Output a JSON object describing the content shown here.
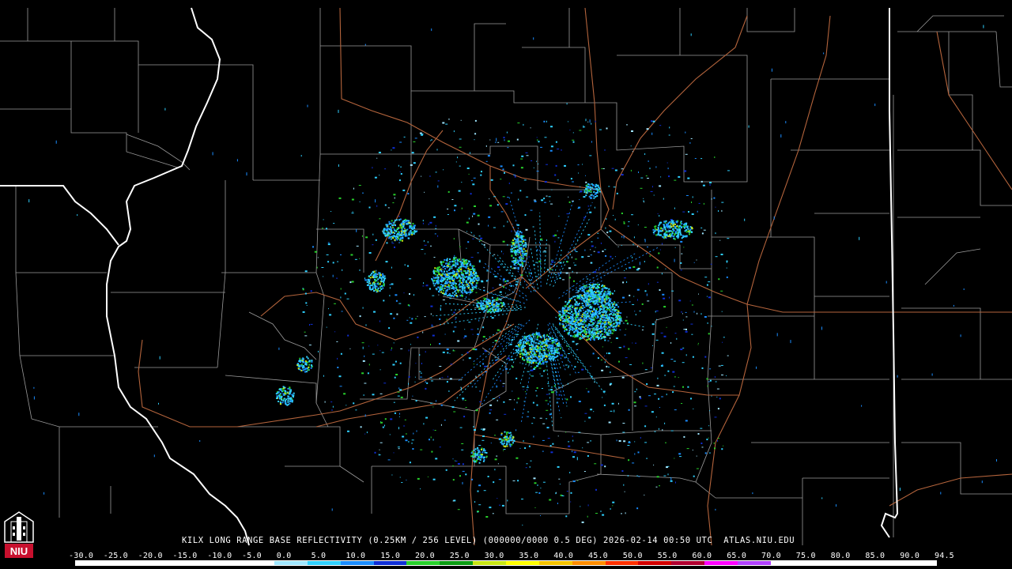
{
  "product": {
    "caption": "KILX LONG RANGE BASE REFLECTIVITY (0.25KM / 256 LEVEL) (000000/0000 0.5 DEG) 2026-02-14 00:50 UTC  ATLAS.NIU.EDU"
  },
  "logo": {
    "text": "NIU"
  },
  "colorscale": {
    "labels": [
      "-30.0",
      "-25.0",
      "-20.0",
      "-15.0",
      "-10.0",
      "-5.0",
      "0.0",
      "5.0",
      "10.0",
      "15.0",
      "20.0",
      "25.0",
      "30.0",
      "35.0",
      "40.0",
      "45.0",
      "50.0",
      "55.0",
      "60.0",
      "65.0",
      "70.0",
      "75.0",
      "80.0",
      "85.0",
      "90.0",
      "94.5"
    ],
    "colors": [
      "#ffffff",
      "#ffffff",
      "#ffffff",
      "#ffffff",
      "#ffffff",
      "#ffffff",
      "#9fe6ff",
      "#2fd0ff",
      "#1a8cff",
      "#0f2fd6",
      "#27d02b",
      "#0a9c12",
      "#c8e614",
      "#ffff00",
      "#f5c400",
      "#ff8c00",
      "#ff3000",
      "#d40000",
      "#b00030",
      "#ff00ff",
      "#b040ff",
      "#ffffff",
      "#ffffff",
      "#ffffff",
      "#ffffff",
      "#ffffff"
    ]
  }
}
